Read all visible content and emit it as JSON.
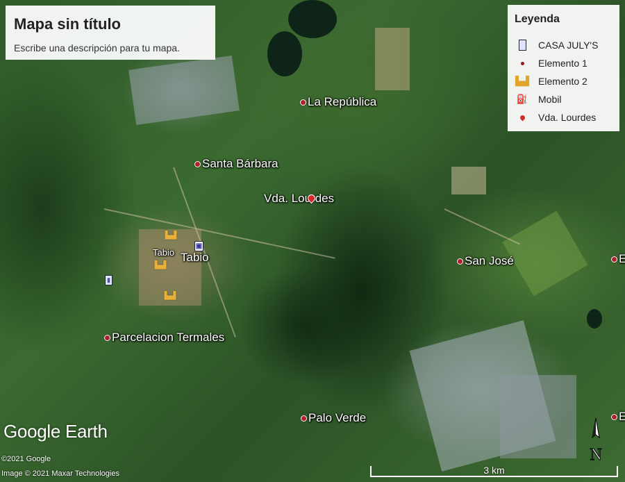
{
  "title_card": {
    "title": "Mapa sin título",
    "description": "Escribe una descripción para tu mapa."
  },
  "legend": {
    "heading": "Leyenda",
    "items": [
      {
        "label": "CASA JULY'S",
        "icon": "house-marker-icon"
      },
      {
        "label": "Elemento 1",
        "icon": "red-dot-icon"
      },
      {
        "label": "Elemento 2",
        "icon": "amphitheater-icon"
      },
      {
        "label": "Mobil",
        "icon": "gas-station-icon"
      },
      {
        "label": "Vda. Lourdes",
        "icon": "red-pin-icon"
      }
    ]
  },
  "places": [
    {
      "label": "La República"
    },
    {
      "label": "Santa Bárbara"
    },
    {
      "label": "Vda. Lourdes"
    },
    {
      "label": "Tabio"
    },
    {
      "label": "Tabio"
    },
    {
      "label": "San José"
    },
    {
      "label": "Parcelacion Termales"
    },
    {
      "label": "Palo Verde"
    },
    {
      "label": "E"
    },
    {
      "label": "E"
    }
  ],
  "branding": {
    "logo_word1": "Google",
    "logo_word2": "Earth",
    "copyright_google": "©2021 Google",
    "copyright_imagery": "Image © 2021 Maxar Technologies"
  },
  "compass": {
    "letter": "N"
  },
  "scale": {
    "label": "3 km"
  },
  "colors": {
    "pin": "#b0202a",
    "vda_pin": "#d62a2a",
    "elemento2": "#e8b13a"
  }
}
